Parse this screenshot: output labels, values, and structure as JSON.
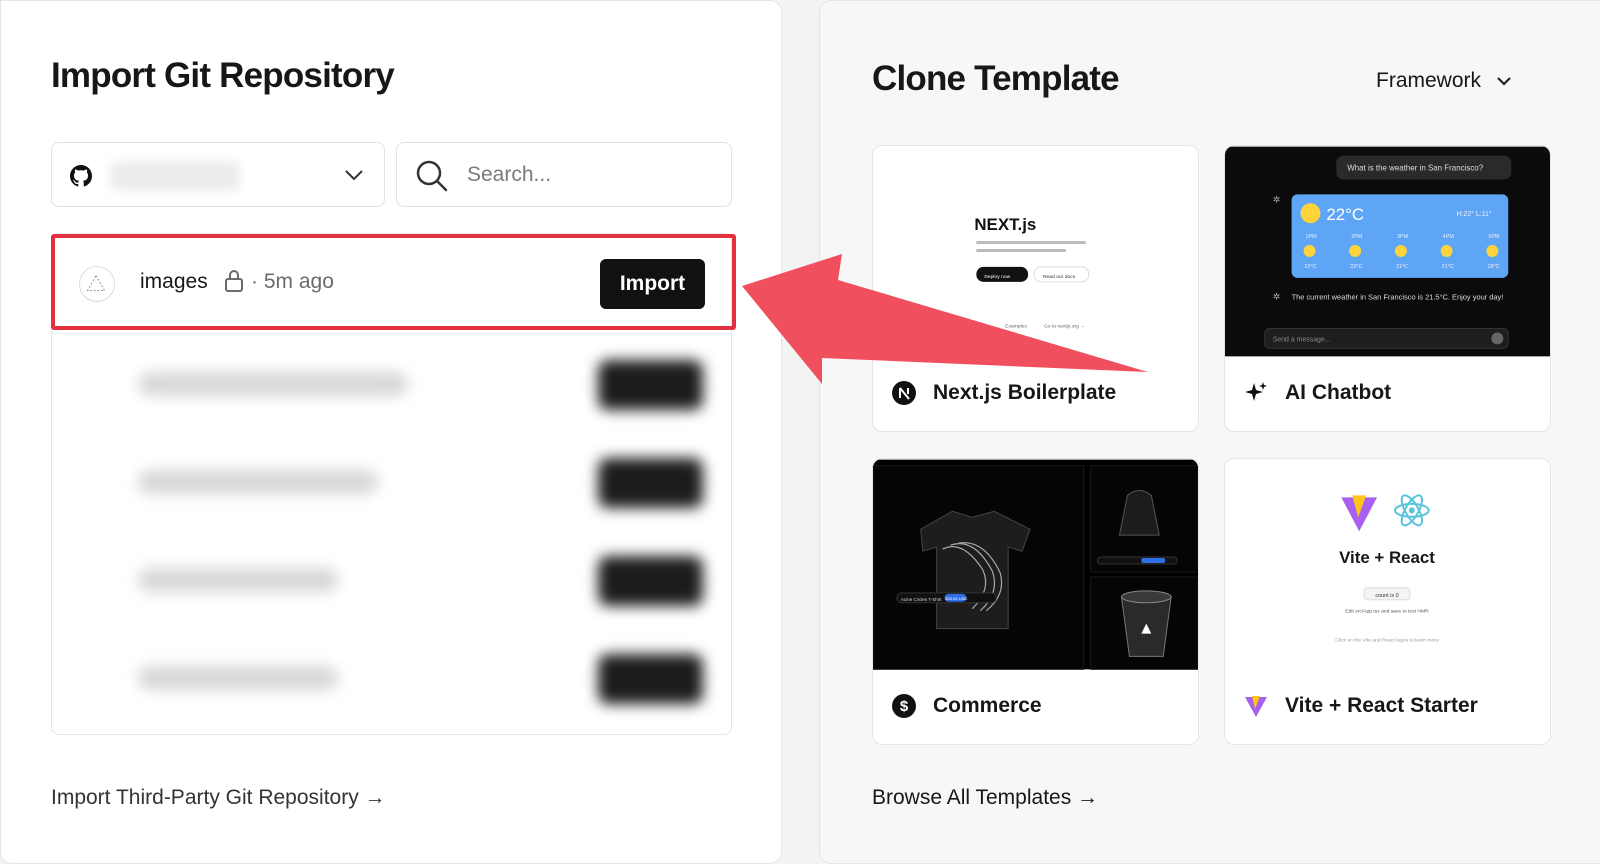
{
  "left": {
    "title": "Import Git Repository",
    "search": {
      "placeholder": "Search..."
    },
    "repos": [
      {
        "name": "images",
        "meta": "· 5m ago",
        "action": "Import"
      }
    ],
    "third_party_link": "Import Third-Party Git Repository →"
  },
  "right": {
    "title": "Clone Template",
    "framework_label": "Framework",
    "templates": [
      {
        "name": "Next.js Boilerplate",
        "icon": "nextjs-icon",
        "preview": {
          "logo": "NEXT.js",
          "buttons": [
            "Deploy now",
            "Read our docs"
          ],
          "footer": [
            "Examples",
            "Go to nextjs.org →"
          ]
        }
      },
      {
        "name": "AI Chatbot",
        "icon": "sparkles-icon",
        "preview": {
          "question": "What is the weather in San Francisco?",
          "temp": "22°C",
          "hilo": "H:22° L:11°",
          "hours": [
            "1PM",
            "2PM",
            "3PM",
            "4PM",
            "5PM"
          ],
          "hour_temps": [
            "22°C",
            "22°C",
            "21°C",
            "21°C",
            "18°C"
          ],
          "answer": "The current weather in San Francisco is 21.5°C. Enjoy your day!",
          "input_placeholder": "Send a message..."
        }
      },
      {
        "name": "Commerce",
        "icon": "dollar-icon",
        "preview": {
          "product": "Acme Circles T-Shirt",
          "price": "$20.00 USD"
        }
      },
      {
        "name": "Vite + React Starter",
        "icon": "vite-icon",
        "preview": {
          "heading": "Vite + React",
          "count": "count is 0",
          "edit": "Edit src/App.tsx and save to test HMR",
          "hint": "Click on the Vite and React logos to learn more"
        }
      }
    ],
    "browse_link": "Browse All Templates →"
  },
  "colors": {
    "highlight": "#e3323f",
    "arrow": "#f0505e",
    "button": "#111111"
  }
}
